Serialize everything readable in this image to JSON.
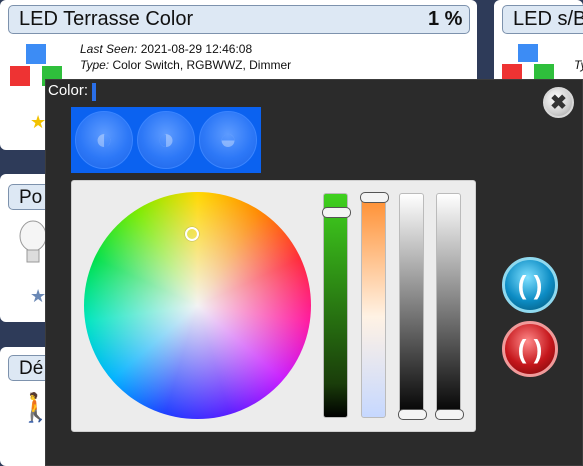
{
  "cards": {
    "led_terrasse": {
      "title": "LED Terrasse Color",
      "level": "1 %",
      "last_seen_label": "Last Seen:",
      "last_seen_value": "2021-08-29 12:46:08",
      "type_label": "Type:",
      "type_value": "Color Switch, RGBWWZ, Dimmer"
    },
    "led_sb": {
      "title": "LED s/B",
      "type_label": "Ty"
    },
    "po": {
      "title": "Po"
    },
    "de": {
      "title": "Dé"
    }
  },
  "dialog": {
    "label": "Color:",
    "close_icon": "close-icon",
    "mode_buttons": [
      "rgb-mode-icon",
      "white-mode-icon",
      "temperature-mode-icon"
    ],
    "apply_icon": "apply-icon",
    "cancel_icon": "cancel-icon",
    "colors": {
      "selected": "#6cff4a",
      "apply": "#0c8cc4",
      "cancel": "#c5161b"
    }
  }
}
